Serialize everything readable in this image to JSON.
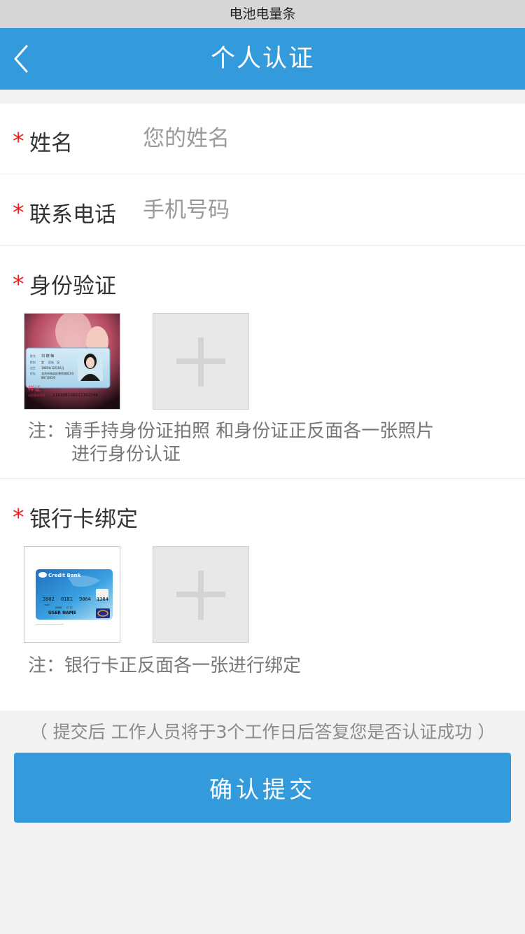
{
  "status_bar": {
    "text": "电池电量条"
  },
  "nav": {
    "back_icon": "chevron-left-icon",
    "title": "个人认证"
  },
  "form": {
    "name": {
      "required_mark": "*",
      "label": "姓名",
      "placeholder": "您的姓名",
      "value": ""
    },
    "phone": {
      "required_mark": "*",
      "label": "联系电话",
      "placeholder": "手机号码",
      "value": ""
    },
    "id_verify": {
      "required_mark": "*",
      "label": "身份验证",
      "sample_image": "id-card-sample",
      "sample_text": {
        "stamp": "样证",
        "number_label": "公民身份号码",
        "number": "110108198512162348",
        "name_label": "姓名",
        "name": "刘 德 梅",
        "gender_label": "性别",
        "gender": "女",
        "ethnicity_label": "民族",
        "ethnicity": "汉",
        "birth_label": "出生",
        "birth": "1985年12月16日",
        "address_label": "住址",
        "address_line1": "北京市海淀区营旁胡同1号",
        "address_line2": "86门302号"
      },
      "add_icon": "plus-icon",
      "note_prefix": "注：",
      "note_line1": "请手持身份证拍照  和身份证正反面各一张照片",
      "note_line2": "进行身份认证"
    },
    "bank_card": {
      "required_mark": "*",
      "label": "银行卡绑定",
      "sample_image": "bank-card-sample",
      "sample_text": {
        "bank_name": "Credit Bank",
        "number_groups": [
          "3902",
          "0181",
          "9864",
          "1384"
        ],
        "issue_no": "3902",
        "valid_from": "0588",
        "valid_thru": "0112",
        "holder": "USER NAME"
      },
      "add_icon": "plus-icon",
      "note": "注：银行卡正反面各一张进行绑定"
    }
  },
  "hint": "（ 提交后 工作人员将于3个工作日后答复您是否认证成功 ）",
  "submit": {
    "label": "确认提交"
  },
  "colors": {
    "primary": "#339bdc",
    "required": "#e8231f",
    "page_bg": "#f2f2f2",
    "placeholder": "#9a9a9a"
  }
}
